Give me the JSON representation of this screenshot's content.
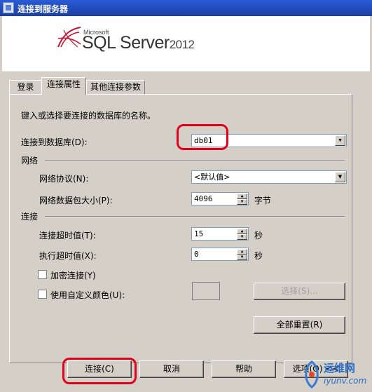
{
  "window": {
    "title": "连接到服务器"
  },
  "banner": {
    "brand": "Microsoft",
    "product": "SQL Server",
    "version": "2012"
  },
  "tabs": [
    {
      "label": "登录"
    },
    {
      "label": "连接属性"
    },
    {
      "label": "其他连接参数"
    }
  ],
  "panel": {
    "instruction": "键入或选择要连接的数据库的名称。",
    "database": {
      "label": "连接到数据库(D):",
      "value": "db01"
    },
    "network_section": "网络",
    "protocol": {
      "label": "网络协议(N):",
      "value": "<默认值>"
    },
    "packet_size": {
      "label": "网络数据包大小(P):",
      "value": "4096",
      "unit": "字节"
    },
    "connection_section": "连接",
    "conn_timeout": {
      "label": "连接超时值(T):",
      "value": "15",
      "unit": "秒"
    },
    "exec_timeout": {
      "label": "执行超时值(X):",
      "value": "0",
      "unit": "秒"
    },
    "encrypt": {
      "label": "加密连接(Y)",
      "checked": false
    },
    "custom_color": {
      "label": "使用自定义颜色(U):",
      "checked": false
    },
    "select_button": "选择(S)...",
    "reset_button": "全部重置(R)"
  },
  "footer": {
    "connect": "连接(C)",
    "cancel": "取消",
    "help": "帮助",
    "options": "选项(O) <<"
  },
  "watermark": {
    "line1": "运维网",
    "line2": "iyunv.com"
  }
}
